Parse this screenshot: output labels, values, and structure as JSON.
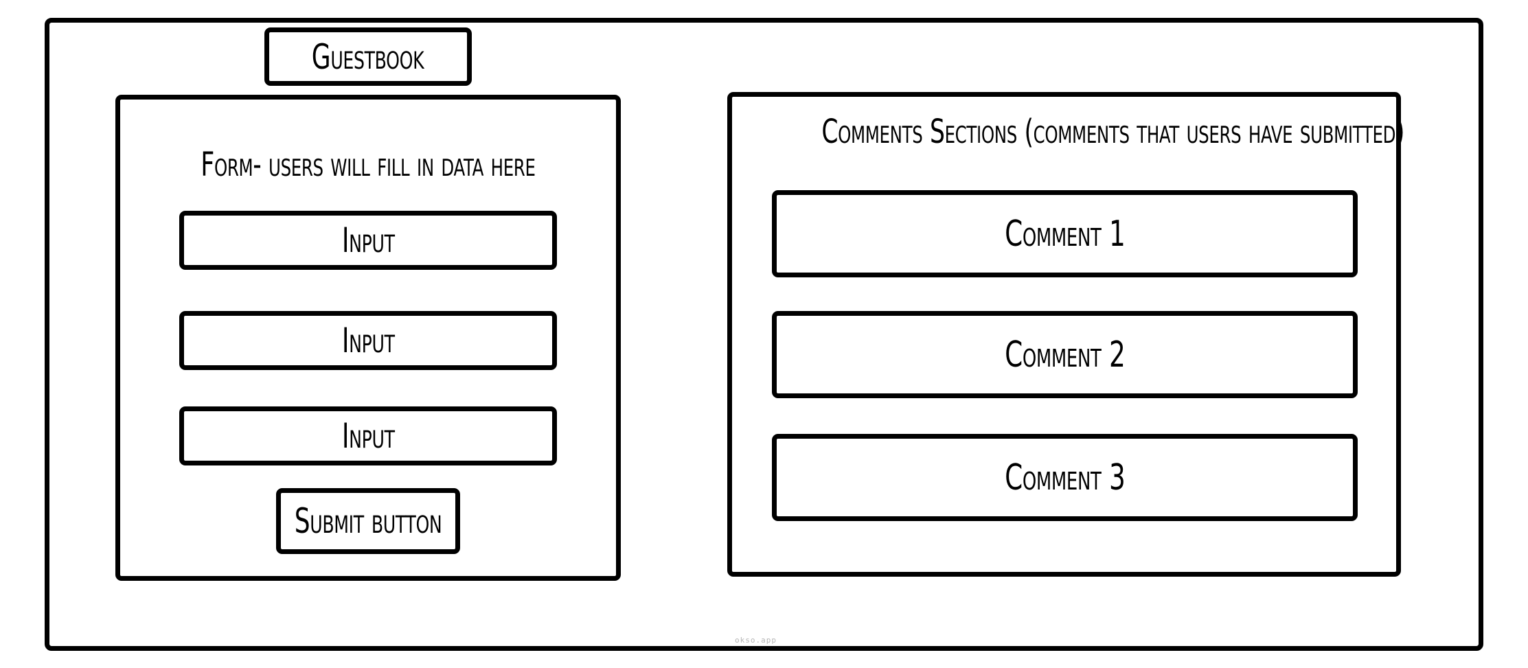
{
  "header": {
    "title": "Guestbook"
  },
  "form": {
    "heading": "Form- users will fill in data here",
    "inputs": [
      {
        "placeholder": "Input"
      },
      {
        "placeholder": "Input"
      },
      {
        "placeholder": "Input"
      }
    ],
    "submit_label": "Submit button"
  },
  "comments": {
    "heading": "Comments Sections (comments that users have submitted)",
    "items": [
      {
        "text": "Comment 1"
      },
      {
        "text": "Comment 2"
      },
      {
        "text": "Comment 3"
      }
    ]
  },
  "footer": {
    "watermark": "okso.app"
  }
}
